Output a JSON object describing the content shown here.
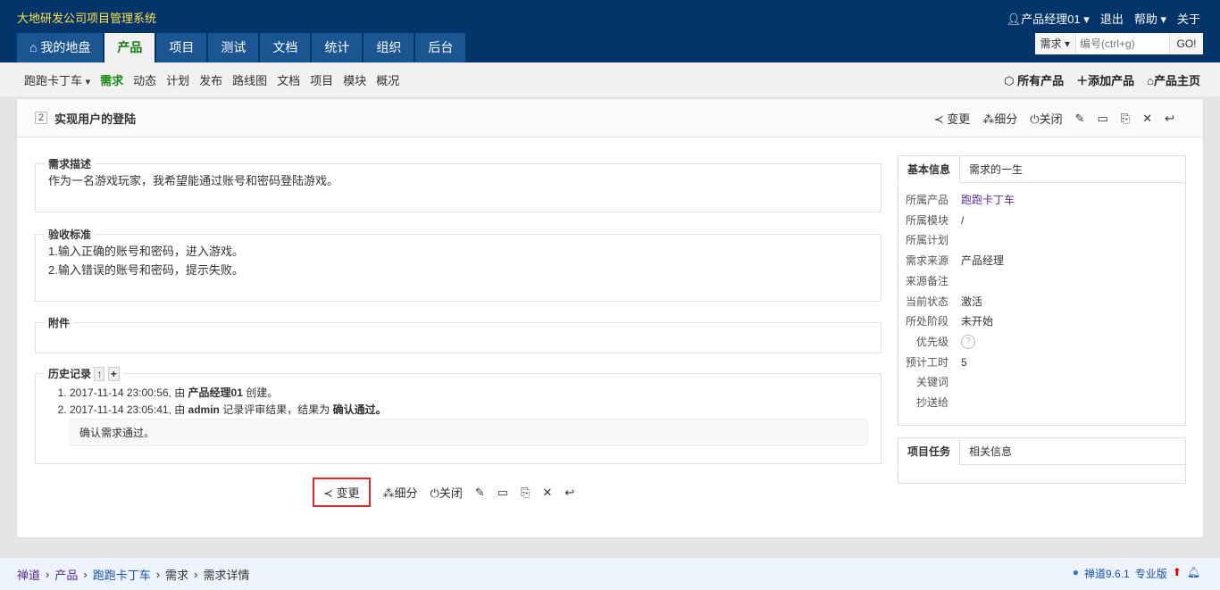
{
  "header": {
    "system_name": "大地研发公司项目管理系统",
    "tabs": [
      "我的地盘",
      "产品",
      "项目",
      "测试",
      "文档",
      "统计",
      "组织",
      "后台"
    ],
    "user": "产品经理01",
    "logout": "退出",
    "help": "帮助",
    "about": "关于",
    "search_type": "需求",
    "search_placeholder": "编号(ctrl+g)",
    "go": "GO!"
  },
  "subnav": {
    "product": "跑跑卡丁车",
    "items": [
      "需求",
      "动态",
      "计划",
      "发布",
      "路线图",
      "文档",
      "项目",
      "模块",
      "概况"
    ],
    "right": [
      "所有产品",
      "添加产品",
      "产品主页"
    ]
  },
  "story": {
    "id": "2",
    "title": "实现用户的登陆"
  },
  "actions": {
    "change": "变更",
    "split": "细分",
    "close": "关闭"
  },
  "desc": {
    "label": "需求描述",
    "text": "作为一名游戏玩家，我希望能通过账号和密码登陆游戏。"
  },
  "verify": {
    "label": "验收标准",
    "lines": [
      "1.输入正确的账号和密码，进入游戏。",
      "2.输入错误的账号和密码，提示失败。"
    ]
  },
  "files": {
    "label": "附件"
  },
  "history": {
    "label": "历史记录",
    "items": [
      {
        "pre": "2017-11-14 23:00:56, 由 ",
        "who": "产品经理01",
        "post": " 创建。"
      },
      {
        "pre": "2017-11-14 23:05:41, 由 ",
        "who": "admin",
        "post": " 记录评审结果，结果为 ",
        "res": "确认通过。"
      }
    ],
    "comment": "确认需求通过。"
  },
  "side": {
    "tabs": [
      "基本信息",
      "需求的一生"
    ],
    "rows": [
      [
        "所属产品",
        "跑跑卡丁车"
      ],
      [
        "所属模块",
        "/"
      ],
      [
        "所属计划",
        ""
      ],
      [
        "需求来源",
        "产品经理"
      ],
      [
        "来源备注",
        ""
      ],
      [
        "当前状态",
        "激活"
      ],
      [
        "所处阶段",
        "未开始"
      ],
      [
        "优先级",
        "?"
      ],
      [
        "预计工时",
        "5"
      ],
      [
        "关键词",
        ""
      ],
      [
        "抄送给",
        ""
      ]
    ],
    "tabs2": [
      "项目任务",
      "相关信息"
    ]
  },
  "footer": {
    "crumbs": [
      "禅道",
      "产品",
      "跑跑卡丁车",
      "需求",
      "需求详情"
    ],
    "version": "禅道9.6.1",
    "edition": "专业版"
  }
}
